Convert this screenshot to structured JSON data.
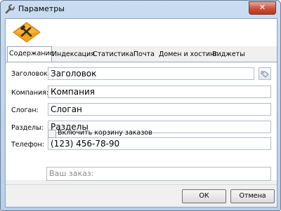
{
  "window": {
    "title": "Параметры",
    "close_glyph": "✕"
  },
  "tabs": [
    {
      "label": "Содержание",
      "active": true
    },
    {
      "label": "Индексация"
    },
    {
      "label": "Статистика"
    },
    {
      "label": "Почта"
    },
    {
      "label": "Домен и хостинг"
    },
    {
      "label": "Виджеты"
    }
  ],
  "form": {
    "title_label": "Заголовок:",
    "title_value": "Заголовок",
    "company_label": "Компания:",
    "company_value": "Компания",
    "slogan_label": "Слоган:",
    "slogan_value": "Слоган",
    "sections_label": "Разделы:",
    "sections_value": "Разделы",
    "phone_label": "Телефон:",
    "phone_value": "(123) 456-78-90",
    "cart_checkbox_label": "Включить корзину заказов",
    "cart_checked": false,
    "order_placeholder": "Ваш заказ:"
  },
  "buttons": {
    "ok": "ОК",
    "cancel": "Отмена"
  },
  "icons": {
    "title": "wrench-icon",
    "logo": "tools-logo-icon",
    "picker": "tag-icon"
  },
  "colors": {
    "logo_orange": "#f3a21c",
    "close_red": "#c9513b"
  }
}
